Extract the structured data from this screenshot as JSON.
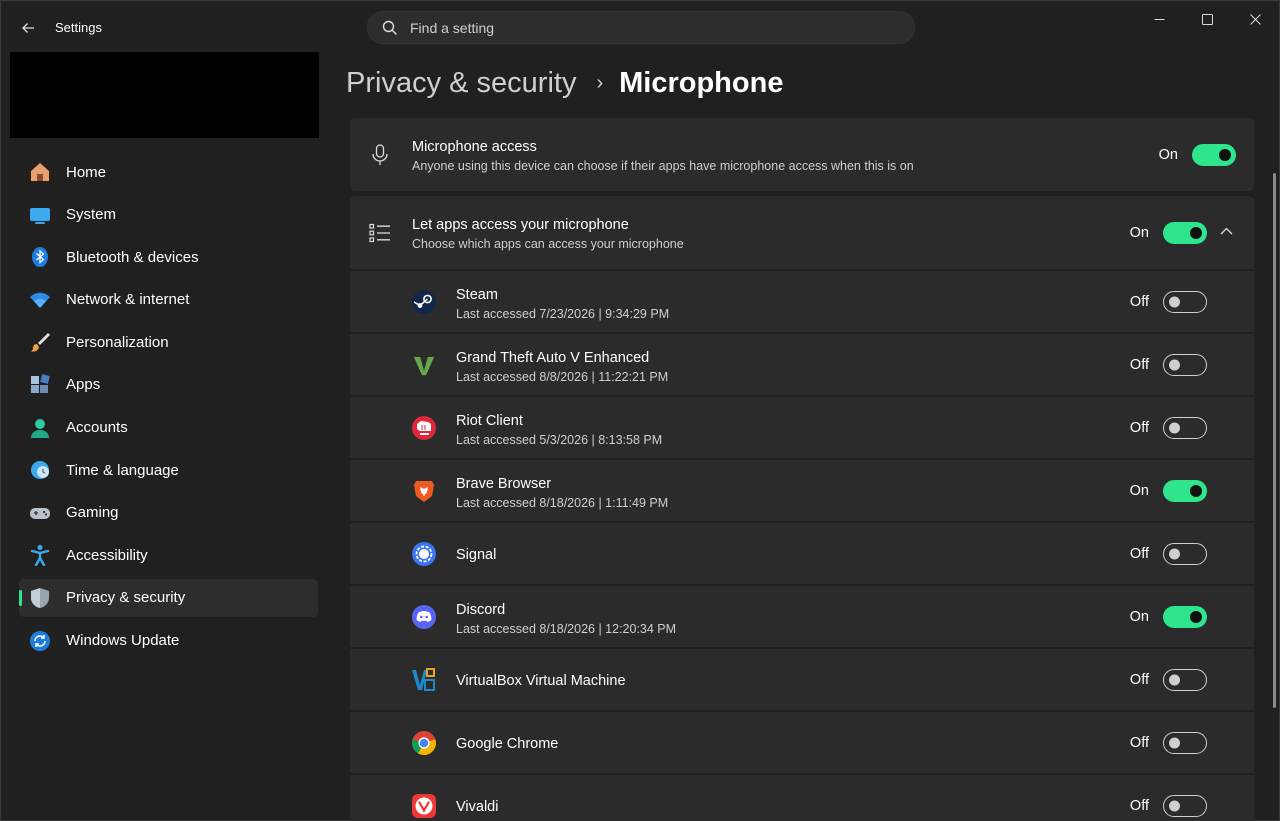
{
  "window": {
    "title": "Settings"
  },
  "search": {
    "placeholder": "Find a setting"
  },
  "sidebar": {
    "items": [
      {
        "label": "Home",
        "icon": "home-icon"
      },
      {
        "label": "System",
        "icon": "system-icon"
      },
      {
        "label": "Bluetooth & devices",
        "icon": "bluetooth-icon"
      },
      {
        "label": "Network & internet",
        "icon": "network-icon"
      },
      {
        "label": "Personalization",
        "icon": "personalization-icon"
      },
      {
        "label": "Apps",
        "icon": "apps-icon"
      },
      {
        "label": "Accounts",
        "icon": "accounts-icon"
      },
      {
        "label": "Time & language",
        "icon": "time-language-icon"
      },
      {
        "label": "Gaming",
        "icon": "gaming-icon"
      },
      {
        "label": "Accessibility",
        "icon": "accessibility-icon"
      },
      {
        "label": "Privacy & security",
        "icon": "privacy-shield-icon",
        "active": true
      },
      {
        "label": "Windows Update",
        "icon": "windows-update-icon"
      }
    ]
  },
  "header": {
    "parent": "Privacy & security",
    "separator": "›",
    "current": "Microphone"
  },
  "microphone_access": {
    "title": "Microphone access",
    "description": "Anyone using this device can choose if their apps have microphone access when this is on",
    "state": "On"
  },
  "app_access": {
    "title": "Let apps access your microphone",
    "description": "Choose which apps can access your microphone",
    "state": "On"
  },
  "apps": [
    {
      "name": "Steam",
      "last_accessed": "Last accessed 7/23/2026  |  9:34:29 PM",
      "state": "Off",
      "icon": "steam-icon"
    },
    {
      "name": "Grand Theft Auto V Enhanced",
      "last_accessed": "Last accessed 8/8/2026  |  11:22:21 PM",
      "state": "Off",
      "icon": "gta-v-icon"
    },
    {
      "name": "Riot Client",
      "last_accessed": "Last accessed 5/3/2026  |  8:13:58 PM",
      "state": "Off",
      "icon": "riot-client-icon"
    },
    {
      "name": "Brave Browser",
      "last_accessed": "Last accessed 8/18/2026  |  1:11:49 PM",
      "state": "On",
      "icon": "brave-icon"
    },
    {
      "name": "Signal",
      "last_accessed": "",
      "state": "Off",
      "icon": "signal-icon"
    },
    {
      "name": "Discord",
      "last_accessed": "Last accessed 8/18/2026  |  12:20:34 PM",
      "state": "On",
      "icon": "discord-icon"
    },
    {
      "name": "VirtualBox Virtual Machine",
      "last_accessed": "",
      "state": "Off",
      "icon": "virtualbox-icon"
    },
    {
      "name": "Google Chrome",
      "last_accessed": "",
      "state": "Off",
      "icon": "chrome-icon"
    },
    {
      "name": "Vivaldi",
      "last_accessed": "",
      "state": "Off",
      "icon": "vivaldi-icon"
    }
  ],
  "colors": {
    "accent": "#2ee58c",
    "background": "#202020",
    "card": "#2b2b2b"
  }
}
